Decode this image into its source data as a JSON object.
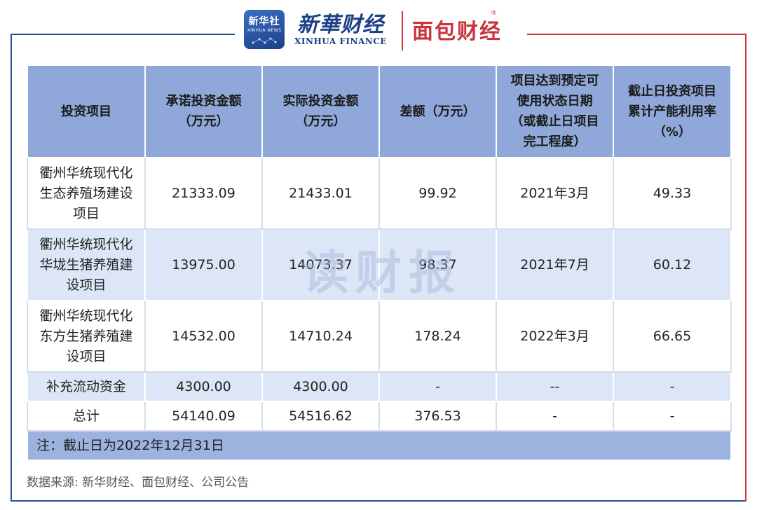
{
  "header": {
    "xinhua_badge_text": "新华社",
    "xinhua_badge_sub": "XINHUA NEWS",
    "xinhua_name": "新華财经",
    "xinhua_sub": "XINHUA FINANCE",
    "mianbao_name": "面包财经",
    "mianbao_reg": "®"
  },
  "table": {
    "headers": [
      "投资项目",
      "承诺投资金额\n（万元）",
      "实际投资金额\n（万元）",
      "差额（万元）",
      "项目达到预定可\n使用状态日期\n（或截止日项目\n完工程度）",
      "截止日投资项目\n累计产能利用率\n（%）"
    ],
    "rows": [
      [
        "衢州华统现代化\n生态养殖场建设\n项目",
        "21333.09",
        "21433.01",
        "99.92",
        "2021年3月",
        "49.33"
      ],
      [
        "衢州华统现代化\n华垅生猪养殖建\n设项目",
        "13975.00",
        "14073.37",
        "98.37",
        "2021年7月",
        "60.12"
      ],
      [
        "衢州华统现代化\n东方生猪养殖建\n设项目",
        "14532.00",
        "14710.24",
        "178.24",
        "2022年3月",
        "66.65"
      ],
      [
        "补充流动资金",
        "4300.00",
        "4300.00",
        "-",
        "--",
        "-"
      ],
      [
        "总计",
        "54140.09",
        "54516.62",
        "376.53",
        "-",
        "-"
      ]
    ],
    "note": "注：截止日为2022年12月31日"
  },
  "watermark": "读财报",
  "source": "数据来源: 新华财经、面包财经、公司公告",
  "colors": {
    "header_bg": "#8fa8d9",
    "row_blue": "#dde6f7",
    "note_bg": "#9db3df",
    "frame_blue": "#2b4f8f",
    "frame_red": "#c9323b"
  }
}
